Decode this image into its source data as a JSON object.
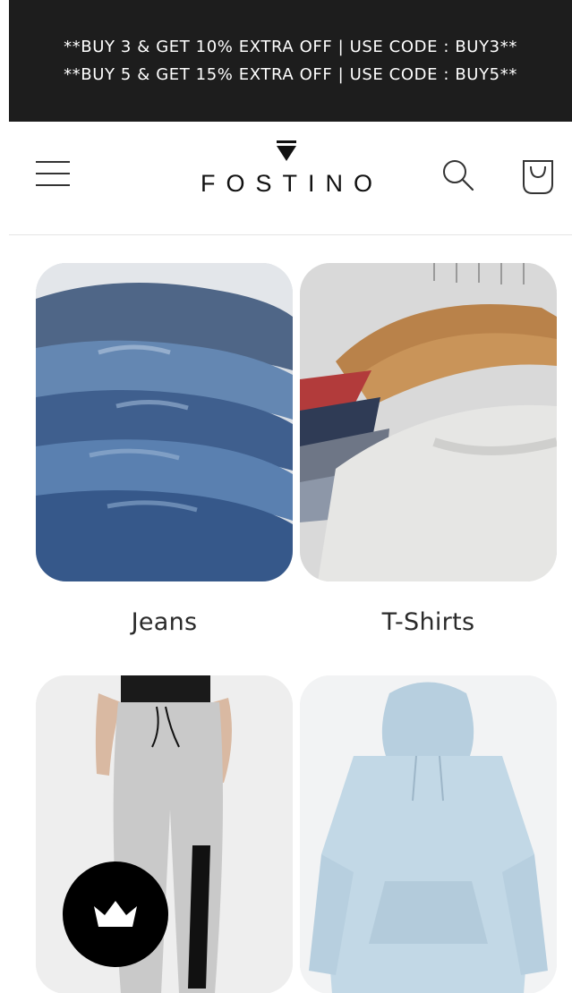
{
  "announcement": {
    "text": "**BUY 3 & GET 10% EXTRA OFF | USE CODE : BUY3** **BUY 5 & GET 15% EXTRA OFF | USE CODE : BUY5**"
  },
  "header": {
    "logo_text": "FOSTINO",
    "menu_icon": "hamburger-menu-icon",
    "search_icon": "search-icon",
    "cart_icon": "cart-bag-icon"
  },
  "collections": [
    {
      "label": "Jeans",
      "image": "stacked denim jeans"
    },
    {
      "label": "T-Shirts",
      "image": "t-shirts on wooden hangers"
    },
    {
      "label": "",
      "image": "grey track pants"
    },
    {
      "label": "",
      "image": "light blue hoodie"
    }
  ],
  "floating_button": {
    "icon": "crown-icon"
  },
  "colors": {
    "announcement_bg": "#1d1d1d",
    "announcement_text": "#ffffff",
    "text": "#222222",
    "divider": "#e4e4e4"
  }
}
